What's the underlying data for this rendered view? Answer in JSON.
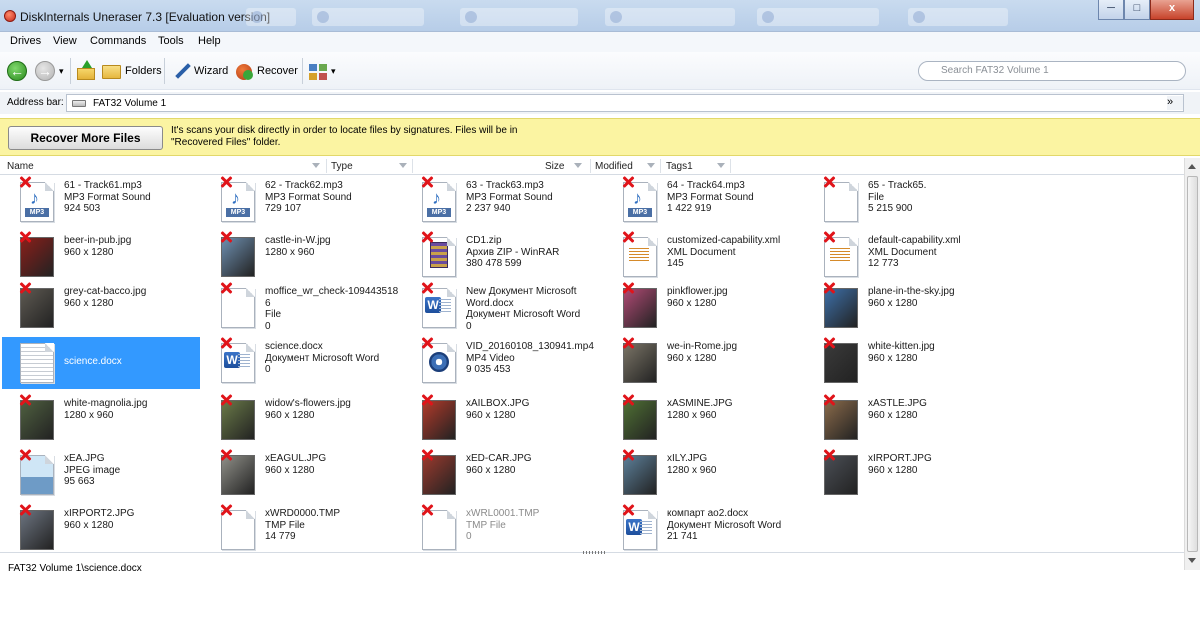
{
  "window": {
    "title": "DiskInternals Uneraser 7.3 [Evaluation version]",
    "min_label": "─",
    "max_label": "□",
    "close_label": "x"
  },
  "menu": [
    "Drives",
    "View",
    "Commands",
    "Tools",
    "Help"
  ],
  "toolbar": {
    "folders_label": "Folders",
    "wizard_label": "Wizard",
    "recover_label": "Recover",
    "dropdown_glyph": "▾"
  },
  "search": {
    "placeholder": "Search FAT32 Volume 1"
  },
  "address": {
    "label": "Address bar:",
    "value": "FAT32 Volume 1"
  },
  "banner": {
    "button_label": "Recover More Files",
    "message": "It's scans your disk directly in order to locate files by signatures. Files will be in \"Recovered Files\" folder."
  },
  "columns": [
    "Name",
    "Type",
    "Size",
    "Modified",
    "Tags1"
  ],
  "files": [
    {
      "lines": [
        "61 - Track61.mp3",
        "MP3 Format Sound",
        "924 503"
      ],
      "icon": "mp3"
    },
    {
      "lines": [
        "62 - Track62.mp3",
        "MP3 Format Sound",
        "729 107"
      ],
      "icon": "mp3"
    },
    {
      "lines": [
        "63 - Track63.mp3",
        "MP3 Format Sound",
        "2 237 940"
      ],
      "icon": "mp3"
    },
    {
      "lines": [
        "64 - Track64.mp3",
        "MP3 Format Sound",
        "1 422 919"
      ],
      "icon": "mp3"
    },
    {
      "lines": [
        "65 - Track65.",
        "File",
        "5 215 900"
      ],
      "icon": "file"
    },
    {
      "lines": [
        "beer-in-pub.jpg",
        "960 x 1280"
      ],
      "icon": "photo",
      "color": "#8a1f1a"
    },
    {
      "lines": [
        "castle-in-W.jpg",
        "1280 x 960"
      ],
      "icon": "photo",
      "color": "#6e8fb0"
    },
    {
      "lines": [
        "CD1.zip",
        "Архив ZIP - WinRAR",
        "380 478 599"
      ],
      "icon": "zip"
    },
    {
      "lines": [
        "customized-capability.xml",
        "XML Document",
        "145"
      ],
      "icon": "xml"
    },
    {
      "lines": [
        "default-capability.xml",
        "XML Document",
        "12 773"
      ],
      "icon": "xml"
    },
    {
      "lines": [
        "grey-cat-bacco.jpg",
        "960 x 1280"
      ],
      "icon": "photo",
      "color": "#5e5a52"
    },
    {
      "lines": [
        "moffice_wr_check-109443518",
        "6",
        "File",
        "0"
      ],
      "icon": "file"
    },
    {
      "lines": [
        "New Документ Microsoft",
        "Word.docx",
        "Документ Microsoft Word",
        "0"
      ],
      "icon": "word"
    },
    {
      "lines": [
        "pinkflower.jpg",
        "960 x 1280"
      ],
      "icon": "photo",
      "color": "#b04a74"
    },
    {
      "lines": [
        "plane-in-the-sky.jpg",
        "960 x 1280"
      ],
      "icon": "photo",
      "color": "#3d6fa8"
    },
    {
      "lines": [
        "science.docx"
      ],
      "icon": "docthumb",
      "selected": true
    },
    {
      "lines": [
        "science.docx",
        "Документ Microsoft Word",
        "0"
      ],
      "icon": "word"
    },
    {
      "lines": [
        "VID_20160108_130941.mp4",
        "MP4 Video",
        "9 035 453"
      ],
      "icon": "video"
    },
    {
      "lines": [
        "we-in-Rome.jpg",
        "960 x 1280"
      ],
      "icon": "photo",
      "color": "#7a7466"
    },
    {
      "lines": [
        "white-kitten.jpg",
        "960 x 1280"
      ],
      "icon": "photo",
      "color": "#3a3a3a"
    },
    {
      "lines": [
        "white-magnolia.jpg",
        "1280 x 960"
      ],
      "icon": "photo",
      "color": "#4f6040"
    },
    {
      "lines": [
        "widow's-flowers.jpg",
        "960 x 1280"
      ],
      "icon": "photo",
      "color": "#6a7a48"
    },
    {
      "lines": [
        "xAILBOX.JPG",
        "960 x 1280"
      ],
      "icon": "photo",
      "color": "#b23a2a"
    },
    {
      "lines": [
        "xASMINE.JPG",
        "1280 x 960"
      ],
      "icon": "photo",
      "color": "#4f7034"
    },
    {
      "lines": [
        "xASTLE.JPG",
        "960 x 1280"
      ],
      "icon": "photo",
      "color": "#8a6a4a"
    },
    {
      "lines": [
        "xEA.JPG",
        "JPEG image",
        "95 663"
      ],
      "icon": "jpegicon"
    },
    {
      "lines": [
        "xEAGUL.JPG",
        "960 x 1280"
      ],
      "icon": "photo",
      "color": "#8f8f88"
    },
    {
      "lines": [
        "xED-CAR.JPG",
        "960 x 1280"
      ],
      "icon": "photo",
      "color": "#9a3a2e"
    },
    {
      "lines": [
        "xILY.JPG",
        "1280 x 960"
      ],
      "icon": "photo",
      "color": "#5c7f99"
    },
    {
      "lines": [
        "xIRPORT.JPG",
        "960 x 1280"
      ],
      "icon": "photo",
      "color": "#4a4e55"
    },
    {
      "lines": [
        "xIRPORT2.JPG",
        "960 x 1280"
      ],
      "icon": "photo",
      "color": "#6c7480"
    },
    {
      "lines": [
        "xWRD0000.TMP",
        "TMP File",
        "14 779"
      ],
      "icon": "file"
    },
    {
      "lines": [
        "xWRL0001.TMP",
        "TMP File",
        "0"
      ],
      "icon": "file",
      "dim": true
    },
    {
      "lines": [
        "компарт ао2.docx",
        "Документ Microsoft Word",
        "21 741"
      ],
      "icon": "word"
    }
  ],
  "status": {
    "path": "FAT32 Volume 1\\science.docx"
  }
}
